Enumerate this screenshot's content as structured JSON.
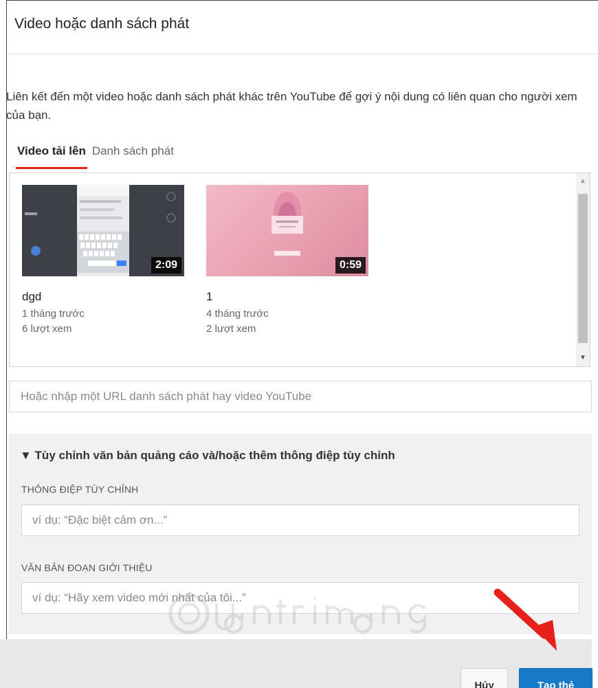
{
  "dialog": {
    "title": "Video hoặc danh sách phát",
    "description": "Liên kết đến một video hoặc danh sách phát khác trên YouTube để gợi ý nội dung có liên quan cho người xem của bạn."
  },
  "tabs": [
    {
      "label": "Video tải lên",
      "active": true
    },
    {
      "label": "Danh sách phát",
      "active": false
    }
  ],
  "videos": [
    {
      "title": "dgd",
      "duration": "2:09",
      "age": "1 tháng trước",
      "views": "6 lượt xem"
    },
    {
      "title": "1",
      "duration": "0:59",
      "age": "4 tháng trước",
      "views": "2 lượt xem"
    }
  ],
  "url_input": {
    "placeholder": "Hoặc nhập một URL danh sách phát hay video YouTube"
  },
  "customize": {
    "toggle_label": "▼ Tùy chỉnh văn bản quảng cáo và/hoặc thêm thông điệp tùy chỉnh",
    "custom_message_label": "THÔNG ĐIỆP TÙY CHỈNH",
    "custom_message_placeholder": "ví dụ: “Đặc biệt cảm ơn...”",
    "teaser_label": "VĂN BẢN ĐOẠN GIỚI THIỆU",
    "teaser_placeholder": "ví dụ: “Hãy xem video mới nhất của tôi...”"
  },
  "buttons": {
    "cancel": "Hủy",
    "create": "Tạo thẻ"
  },
  "colors": {
    "tab_underline": "#e62117",
    "primary_button": "#167ac6",
    "arrow": "#e8201c"
  }
}
